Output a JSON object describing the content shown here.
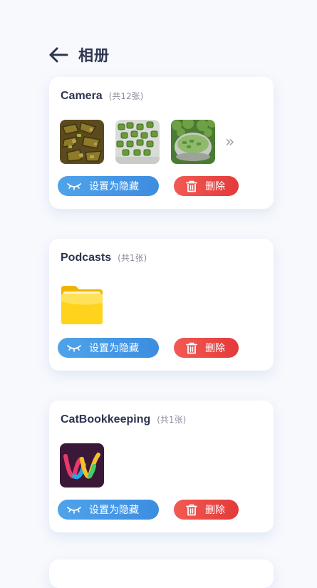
{
  "header": {
    "title": "相册",
    "back_icon": "arrow-left-icon"
  },
  "albums": [
    {
      "name": "Camera",
      "count": "(共12张)",
      "hide_label": "设置为隐藏",
      "delete_label": "删除"
    },
    {
      "name": "Podcasts",
      "count": "(共1张)",
      "hide_label": "设置为隐藏",
      "delete_label": "删除"
    },
    {
      "name": "CatBookkeeping",
      "count": "(共1张)",
      "hide_label": "设置为隐藏",
      "delete_label": "删除"
    }
  ],
  "more_icon": "double-chevron-right-icon",
  "colors": {
    "hide_button": "#3d8de0",
    "delete_button": "#e33a3a",
    "title": "#2e3550",
    "background": "#f7f9fd"
  }
}
